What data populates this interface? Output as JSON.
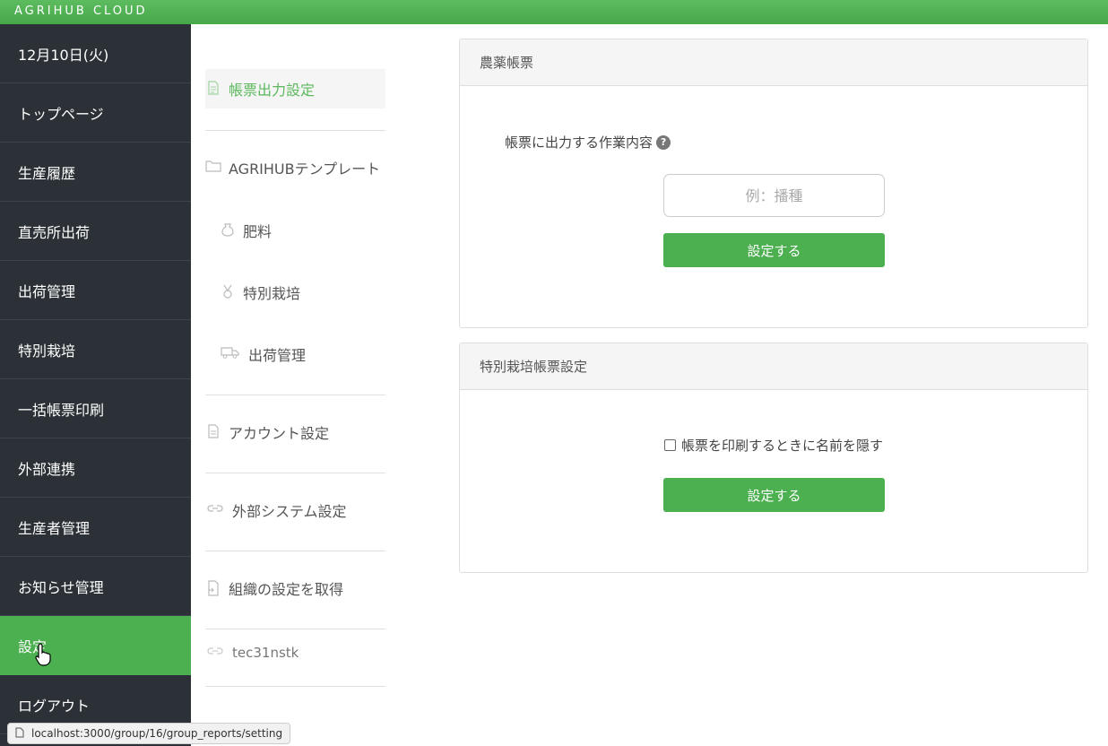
{
  "app": {
    "brand": "AGRIHUB CLOUD"
  },
  "sidebar": {
    "items": [
      {
        "label": "12月10日(火)"
      },
      {
        "label": "トップページ"
      },
      {
        "label": "生産履歴"
      },
      {
        "label": "直売所出荷"
      },
      {
        "label": "出荷管理"
      },
      {
        "label": "特別栽培"
      },
      {
        "label": "一括帳票印刷"
      },
      {
        "label": "外部連携"
      },
      {
        "label": "生産者管理"
      },
      {
        "label": "お知らせ管理"
      },
      {
        "label": "設定"
      },
      {
        "label": "ログアウト"
      }
    ],
    "active_index": 10
  },
  "subnav": {
    "report_settings": "帳票出力設定",
    "template": "AGRIHUBテンプレート",
    "fertilizer": "肥料",
    "special_cultivation": "特別栽培",
    "shipping": "出荷管理",
    "account": "アカウント設定",
    "external_system": "外部システム設定",
    "org_settings": "組織の設定を取得",
    "account_id": "tec31nstk"
  },
  "pesticide_card": {
    "title": "農薬帳票",
    "label": "帳票に出力する作業内容",
    "help": "?",
    "placeholder": "例：播種",
    "value": "",
    "button": "設定する"
  },
  "special_card": {
    "title": "特別栽培帳票設定",
    "checkbox_label": "帳票を印刷するときに名前を隠す",
    "checked": false,
    "button": "設定する"
  },
  "statusbar": {
    "url": "localhost:3000/group/16/group_reports/setting"
  },
  "colors": {
    "accent": "#4caf50",
    "sidebar_bg": "#2b3136"
  }
}
